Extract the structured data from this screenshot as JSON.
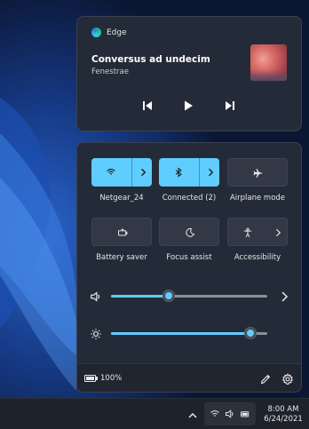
{
  "media": {
    "app": "Edge",
    "title": "Conversus ad undecim",
    "artist": "Fenestrae",
    "art_icon": "album-art"
  },
  "tiles": [
    {
      "label": "Netgear_24",
      "icon": "wifi-icon",
      "active": true,
      "has_chevron": true
    },
    {
      "label": "Connected (2)",
      "icon": "bluetooth-icon",
      "active": true,
      "has_chevron": true
    },
    {
      "label": "Airplane mode",
      "icon": "airplane-icon",
      "active": false,
      "has_chevron": false
    },
    {
      "label": "Battery saver",
      "icon": "battery-saver-icon",
      "active": false,
      "has_chevron": false
    },
    {
      "label": "Focus assist",
      "icon": "moon-icon",
      "active": false,
      "has_chevron": false
    },
    {
      "label": "Accessibility",
      "icon": "accessibility-icon",
      "active": false,
      "has_chevron": true
    }
  ],
  "sliders": {
    "volume": {
      "icon": "speaker-icon",
      "value": 0.37,
      "has_chevron": true
    },
    "brightness": {
      "icon": "sun-icon",
      "value": 0.89
    }
  },
  "footer": {
    "battery": "100%",
    "edit_icon": "pencil-icon",
    "settings_icon": "gear-icon"
  },
  "taskbar": {
    "time": "8:00 AM",
    "date": "6/24/2021"
  },
  "colors": {
    "accent": "#60cdff",
    "panel": "#242b38",
    "tile_off": "#323845"
  }
}
